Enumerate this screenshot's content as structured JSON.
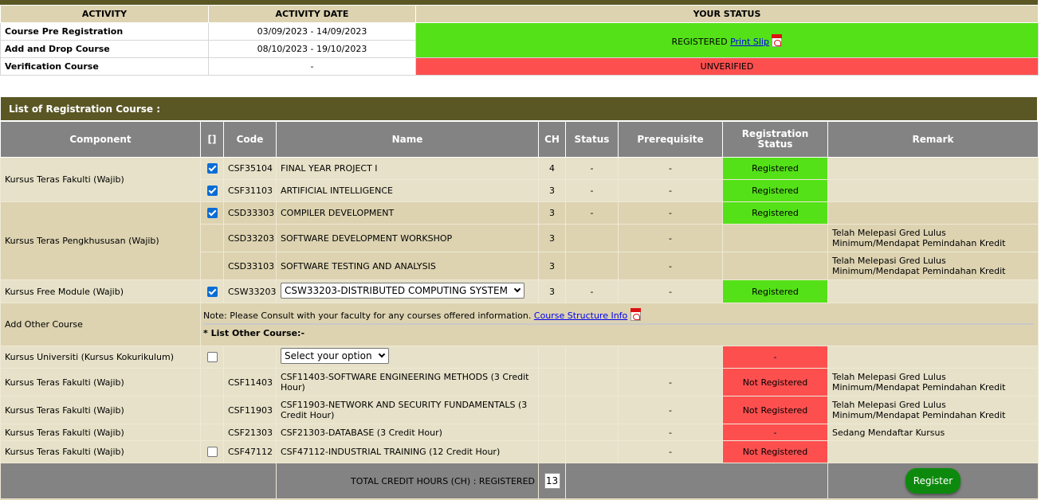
{
  "activity_table": {
    "headers": [
      "ACTIVITY",
      "ACTIVITY DATE",
      "YOUR STATUS"
    ],
    "rows": [
      {
        "activity": "Course Pre Registration",
        "date": "03/09/2023 - 14/09/2023"
      },
      {
        "activity": "Add and Drop Course",
        "date": "08/10/2023 - 19/10/2023"
      },
      {
        "activity": "Verification Course",
        "date": "-"
      }
    ],
    "status_registered": "REGISTERED",
    "print_slip": "Print Slip",
    "status_unverified": "UNVERIFIED"
  },
  "registration": {
    "title": "List of Registration Course :",
    "headers": {
      "component": "Component",
      "check": "[]",
      "code": "Code",
      "name": "Name",
      "ch": "CH",
      "status": "Status",
      "prerequisite": "Prerequisite",
      "reg_status": "Registration Status",
      "remark": "Remark"
    },
    "components": {
      "fakulti": "Kursus Teras Fakulti (Wajib)",
      "pengkhususan": "Kursus Teras Pengkhususan (Wajib)",
      "free": "Kursus Free Module (Wajib)",
      "other": "Add Other Course",
      "universiti": "Kursus Universiti (Kursus Kokurikulum)"
    },
    "rows": [
      {
        "code": "CSF35104",
        "name": "FINAL YEAR PROJECT I",
        "ch": "4",
        "status": "-",
        "prereq": "-",
        "reg": "Registered",
        "remark": ""
      },
      {
        "code": "CSF31103",
        "name": "ARTIFICIAL INTELLIGENCE",
        "ch": "3",
        "status": "-",
        "prereq": "-",
        "reg": "Registered",
        "remark": ""
      },
      {
        "code": "CSD33303",
        "name": "COMPILER DEVELOPMENT",
        "ch": "3",
        "status": "-",
        "prereq": "-",
        "reg": "Registered",
        "remark": ""
      },
      {
        "code": "CSD33203",
        "name": "SOFTWARE DEVELOPMENT WORKSHOP",
        "ch": "3",
        "status": "",
        "prereq": "-",
        "reg": "",
        "remark": "Telah Melepasi Gred Lulus Minimum/Mendapat Pemindahan Kredit"
      },
      {
        "code": "CSD33103",
        "name": "SOFTWARE TESTING AND ANALYSIS",
        "ch": "3",
        "status": "",
        "prereq": "-",
        "reg": "",
        "remark": "Telah Melepasi Gred Lulus Minimum/Mendapat Pemindahan Kredit"
      },
      {
        "code": "CSW33203",
        "name": "CSW33203-DISTRIBUTED COMPUTING SYSTEM",
        "ch": "3",
        "status": "-",
        "prereq": "-",
        "reg": "Registered",
        "remark": ""
      }
    ],
    "note": "Note: Please Consult with your faculty for any courses offered information.",
    "structure_link": "Course Structure Info",
    "list_other": "* List Other Course:-",
    "select_placeholder": "Select your option",
    "other_rows": [
      {
        "code": "",
        "name": "",
        "ch": "",
        "prereq": "",
        "reg": "-",
        "remark": ""
      },
      {
        "code": "CSF11403",
        "name": "CSF11403-SOFTWARE ENGINEERING METHODS (3 Credit Hour)",
        "prereq": "-",
        "reg": "Not Registered",
        "remark": "Telah Melepasi Gred Lulus Minimum/Mendapat Pemindahan Kredit"
      },
      {
        "code": "CSF11903",
        "name": "CSF11903-NETWORK AND SECURITY FUNDAMENTALS (3 Credit Hour)",
        "prereq": "-",
        "reg": "Not Registered",
        "remark": "Telah Melepasi Gred Lulus Minimum/Mendapat Pemindahan Kredit"
      },
      {
        "code": "CSF21303",
        "name": "CSF21303-DATABASE (3 Credit Hour)",
        "prereq": "-",
        "reg": "-",
        "remark": "Sedang Mendaftar Kursus"
      },
      {
        "code": "CSF47112",
        "name": "CSF47112-INDUSTRIAL TRAINING (12 Credit Hour)",
        "prereq": "-",
        "reg": "Not Registered",
        "remark": ""
      }
    ],
    "total_label": "TOTAL CREDIT HOURS (CH) : REGISTERED",
    "total_value": "13",
    "register_button": "Register"
  },
  "colors": {
    "header_olive": "#5b5725",
    "green": "#54e118",
    "red": "#fe4f4f",
    "button_green": "#0d8a0d"
  }
}
